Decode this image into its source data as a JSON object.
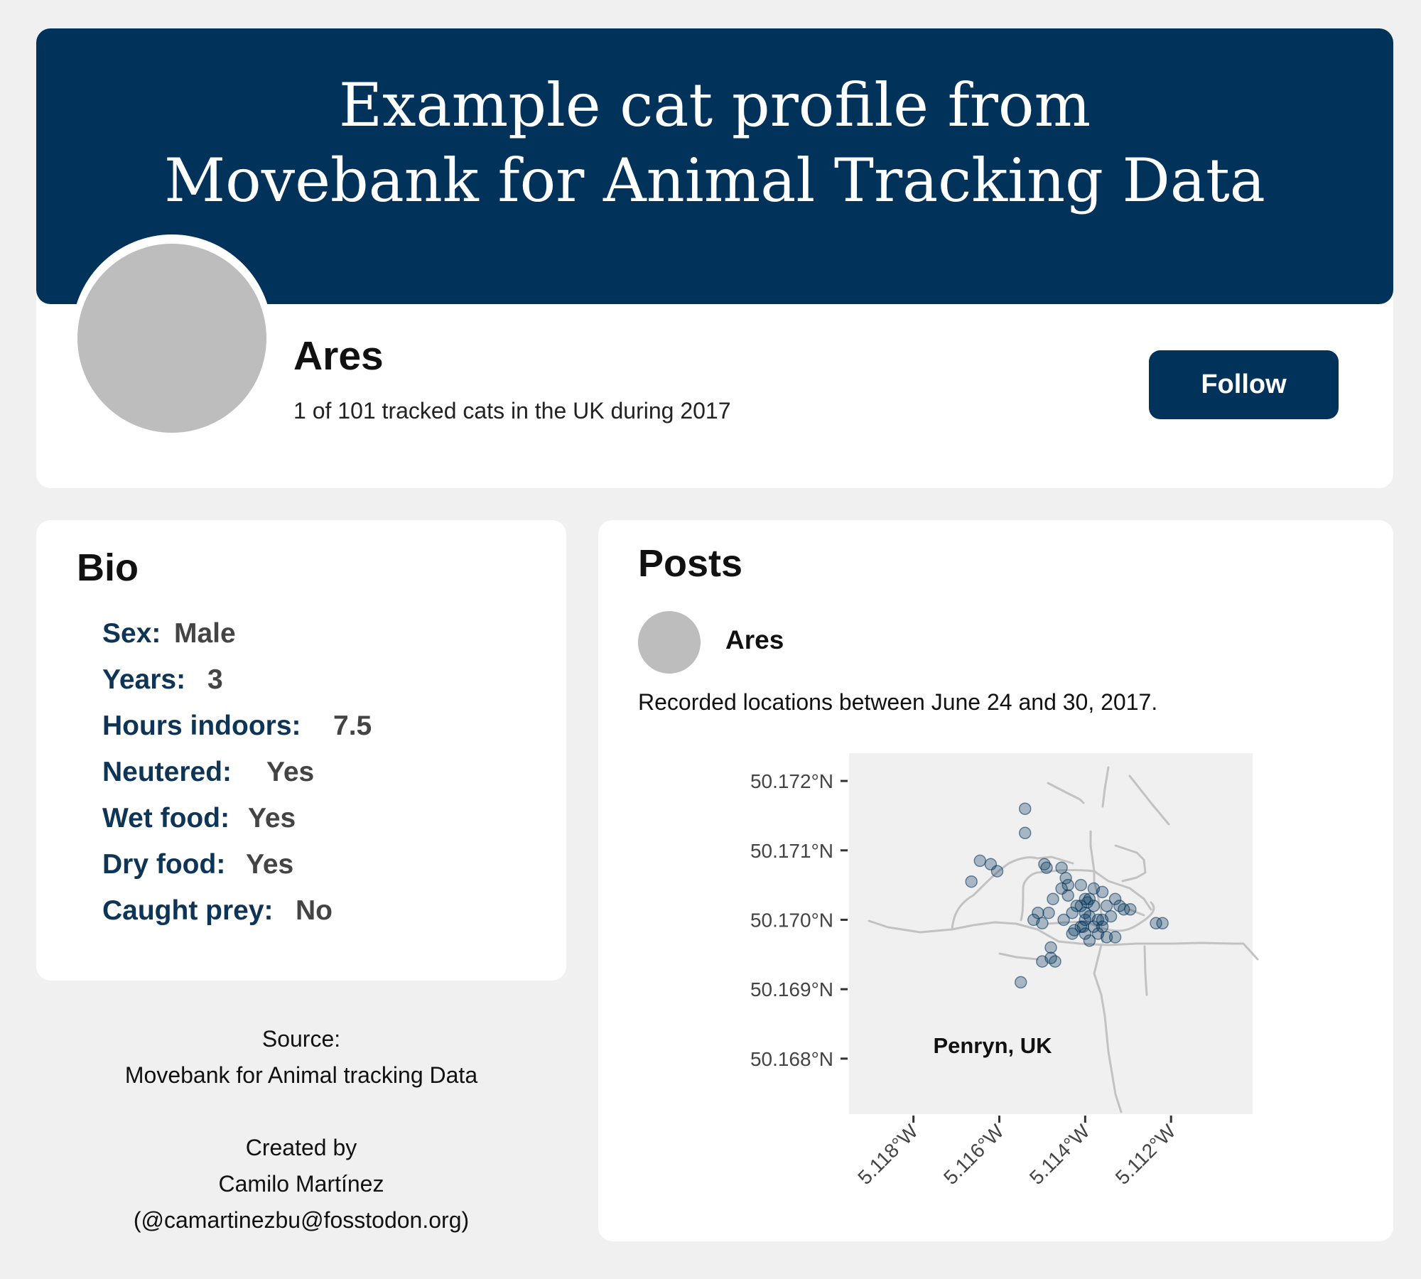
{
  "header": {
    "title_line1": "Example cat profile from",
    "title_line2": "Movebank for Animal Tracking Data",
    "colors": {
      "banner": "#01325a",
      "accent": "#0f3556"
    }
  },
  "profile": {
    "name": "Ares",
    "subtitle": "1 of 101 tracked cats in the UK during 2017",
    "follow_label": "Follow"
  },
  "bio": {
    "heading": "Bio",
    "rows": [
      {
        "label": "Sex:",
        "value": "Male"
      },
      {
        "label": "Years:",
        "value": "3"
      },
      {
        "label": "Hours indoors:",
        "value": "7.5"
      },
      {
        "label": "Neutered:",
        "value": "Yes"
      },
      {
        "label": "Wet food:",
        "value": "Yes"
      },
      {
        "label": "Dry food:",
        "value": "Yes"
      },
      {
        "label": "Caught prey:",
        "value": "No"
      }
    ]
  },
  "credits": {
    "source_label": "Source:",
    "source_name": "Movebank for Animal tracking Data",
    "created_by": "Created by",
    "author": "Camilo Martínez",
    "handle": "(@camartinezbu@fosstodon.org)"
  },
  "posts": {
    "heading": "Posts",
    "author": "Ares",
    "text": "Recorded locations between June 24 and 30, 2017."
  },
  "chart_data": {
    "type": "scatter",
    "title": "",
    "xlabel": "",
    "ylabel": "",
    "annotation": "Penryn, UK",
    "x_ticks": [
      "5.118°W",
      "5.116°W",
      "5.114°W",
      "5.112°W"
    ],
    "y_ticks": [
      "50.172°N",
      "50.171°N",
      "50.170°N",
      "50.169°N",
      "50.168°N"
    ],
    "xlim": [
      -5.1195,
      -5.1101
    ],
    "ylim": [
      50.1672,
      50.1724
    ],
    "point_color": "#01325a",
    "road_color": "#c2c2c2",
    "points": [
      [
        -5.1154,
        50.1716
      ],
      [
        -5.1154,
        50.17125
      ],
      [
        -5.11645,
        50.17085
      ],
      [
        -5.1162,
        50.1708
      ],
      [
        -5.11665,
        50.17055
      ],
      [
        -5.11605,
        50.1707
      ],
      [
        -5.11495,
        50.1708
      ],
      [
        -5.1149,
        50.17075
      ],
      [
        -5.11455,
        50.17075
      ],
      [
        -5.11445,
        50.1706
      ],
      [
        -5.1144,
        50.1705
      ],
      [
        -5.1141,
        50.1705
      ],
      [
        -5.114,
        50.1703
      ],
      [
        -5.1138,
        50.17045
      ],
      [
        -5.1136,
        50.1704
      ],
      [
        -5.1135,
        50.1702
      ],
      [
        -5.1133,
        50.1703
      ],
      [
        -5.1132,
        50.1702
      ],
      [
        -5.11455,
        50.17045
      ],
      [
        -5.11475,
        50.1703
      ],
      [
        -5.11485,
        50.1701
      ],
      [
        -5.1144,
        50.17035
      ],
      [
        -5.1143,
        50.1701
      ],
      [
        -5.1141,
        50.1702
      ],
      [
        -5.114,
        50.17
      ],
      [
        -5.1139,
        50.17005
      ],
      [
        -5.1138,
        50.1702
      ],
      [
        -5.1137,
        50.17
      ],
      [
        -5.1139,
        50.1703
      ],
      [
        -5.1142,
        50.1702
      ],
      [
        -5.114,
        50.1701
      ],
      [
        -5.11395,
        50.17025
      ],
      [
        -5.11405,
        50.1699
      ],
      [
        -5.1138,
        50.1699
      ],
      [
        -5.1136,
        50.17
      ],
      [
        -5.1134,
        50.17005
      ],
      [
        -5.1131,
        50.17015
      ],
      [
        -5.11295,
        50.17015
      ],
      [
        -5.1137,
        50.1698
      ],
      [
        -5.1139,
        50.1697
      ],
      [
        -5.1143,
        50.1698
      ],
      [
        -5.1145,
        50.17
      ],
      [
        -5.11425,
        50.16985
      ],
      [
        -5.1135,
        50.16975
      ],
      [
        -5.1133,
        50.16975
      ],
      [
        -5.114,
        50.1698
      ],
      [
        -5.1136,
        50.1699
      ],
      [
        -5.1141,
        50.1699
      ],
      [
        -5.1151,
        50.1701
      ],
      [
        -5.1152,
        50.17
      ],
      [
        -5.115,
        50.16995
      ],
      [
        -5.1148,
        50.1696
      ],
      [
        -5.1148,
        50.16945
      ],
      [
        -5.115,
        50.1694
      ],
      [
        -5.1147,
        50.1694
      ],
      [
        -5.1155,
        50.1691
      ],
      [
        -5.11235,
        50.16995
      ],
      [
        -5.1122,
        50.16995
      ]
    ]
  }
}
